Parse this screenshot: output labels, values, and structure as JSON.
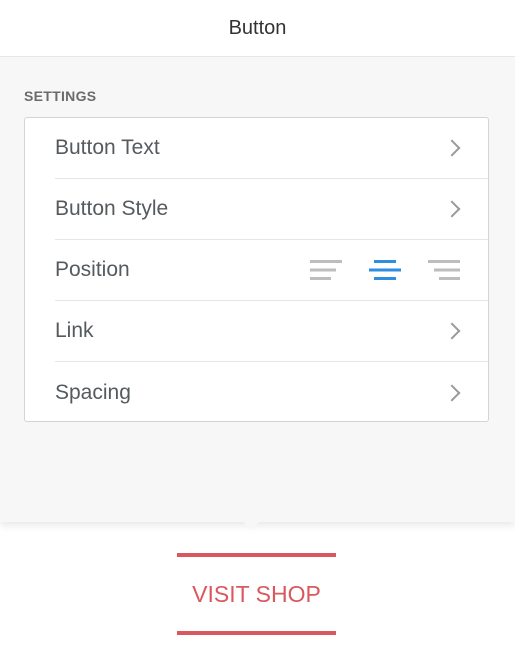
{
  "header": {
    "title": "Button"
  },
  "settings": {
    "heading": "SETTINGS",
    "rows": [
      {
        "label": "Button Text",
        "control": "chevron-right-icon"
      },
      {
        "label": "Button Style",
        "control": "chevron-right-icon"
      },
      {
        "label": "Position",
        "control": "alignment"
      },
      {
        "label": "Link",
        "control": "chevron-right-icon"
      },
      {
        "label": "Spacing",
        "control": "chevron-right-icon"
      }
    ],
    "alignment": {
      "options": [
        "align-left-icon",
        "align-center-icon",
        "align-right-icon"
      ],
      "selected": "align-center-icon",
      "selected_color": "#2f8ee0",
      "inactive_color": "#bdbdbd"
    }
  },
  "preview": {
    "button_label": "VISIT SHOP",
    "accent_color": "#d8585e"
  }
}
